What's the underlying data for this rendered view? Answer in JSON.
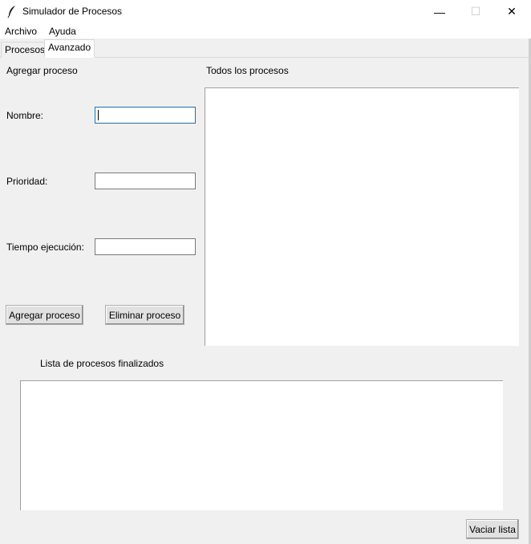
{
  "window": {
    "title": "Simulador de Procesos",
    "min_glyph": "—",
    "max_glyph": "☐",
    "close_glyph": "✕",
    "icon": "feather-icon"
  },
  "menu": {
    "items": [
      "Archivo",
      "Ayuda"
    ]
  },
  "tabs": [
    {
      "label": "Procesos",
      "selected": false
    },
    {
      "label": "Avanzado",
      "selected": true
    }
  ],
  "form": {
    "section_title": "Agregar proceso",
    "nombre_label": "Nombre:",
    "nombre_value": "",
    "prioridad_label": "Prioridad:",
    "prioridad_value": "",
    "tiempo_label": "Tiempo ejecución:",
    "tiempo_value": "",
    "add_button": "Agregar proceso",
    "remove_button": "Eliminar proceso"
  },
  "all_processes": {
    "title": "Todos los procesos",
    "items": []
  },
  "finished": {
    "title": "Lista de procesos finalizados",
    "items": [],
    "clear_button": "Vaciar lista"
  }
}
